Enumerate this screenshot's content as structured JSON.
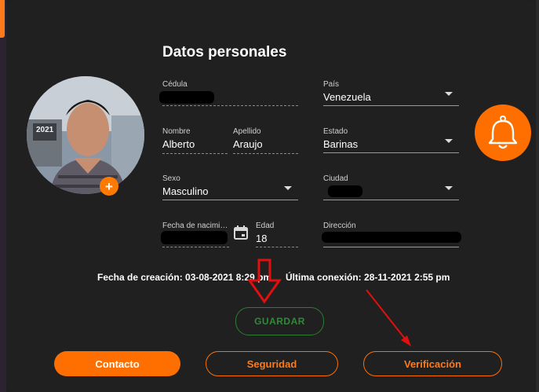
{
  "title": "Datos personales",
  "fields": {
    "cedula": {
      "label": "Cédula",
      "value": ""
    },
    "pais": {
      "label": "País",
      "value": "Venezuela"
    },
    "nombre": {
      "label": "Nombre",
      "value": "Alberto"
    },
    "apellido": {
      "label": "Apellido",
      "value": "Araujo"
    },
    "estado": {
      "label": "Estado",
      "value": "Barinas"
    },
    "sexo": {
      "label": "Sexo",
      "value": "Masculino"
    },
    "ciudad": {
      "label": "Ciudad",
      "value": ""
    },
    "fecha_nacimiento": {
      "label": "Fecha de nacimiento",
      "value": ""
    },
    "edad": {
      "label": "Edad",
      "value": "18"
    },
    "direccion": {
      "label": "Dirección",
      "value": ""
    }
  },
  "avatar": {
    "badge_text": "2021",
    "add_symbol": "+"
  },
  "meta": {
    "created": "Fecha de creación: 03-08-2021 8:29 pm",
    "last_connection": "Última conexión: 28-11-2021 2:55 pm"
  },
  "buttons": {
    "guardar": "GUARDAR",
    "contacto": "Contacto",
    "seguridad": "Seguridad",
    "verificacion": "Verificación"
  },
  "icons": {
    "bell": "bell-icon",
    "calendar": "calendar-icon",
    "dropdown": "chevron-down-icon"
  },
  "colors": {
    "accent": "#ff6f00",
    "guardar": "#2e7d32",
    "annotation": "#e01010",
    "background": "#202020"
  }
}
